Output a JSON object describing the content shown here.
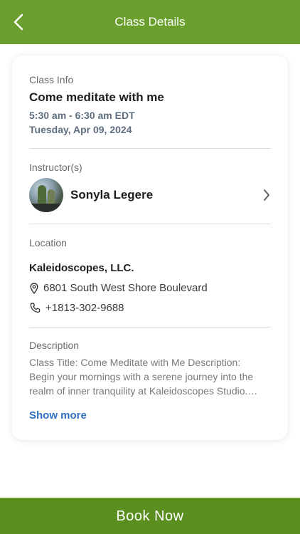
{
  "colors": {
    "header_bg": "#6a9f2d",
    "book_button_bg": "#5a8f1f",
    "link": "#2f6fc0",
    "secondary_text": "#5e6e7e"
  },
  "header": {
    "title": "Class Details",
    "back_icon": "chevron-left-icon"
  },
  "class_info": {
    "label": "Class Info",
    "title": "Come meditate with me",
    "time": "5:30 am - 6:30 am EDT",
    "date": "Tuesday, Apr 09, 2024"
  },
  "instructors": {
    "label": "Instructor(s)",
    "name": "Sonyla Legere",
    "icon": "chevron-right-icon"
  },
  "location": {
    "label": "Location",
    "venue": "Kaleidoscopes, LLC.",
    "address": "6801 South West Shore Boulevard",
    "phone": "+1813-302-9688",
    "address_icon": "map-pin-icon",
    "phone_icon": "phone-icon"
  },
  "description": {
    "label": "Description",
    "text": "Class Title: Come Meditate with Me Description: Begin your mornings with a serene journey into the realm of inner tranquility at Kaleidoscopes Studio. Discover the calm within as we guide you through gentle breathing and mindful practice.",
    "show_more": "Show more"
  },
  "footer": {
    "book_label": "Book Now"
  }
}
